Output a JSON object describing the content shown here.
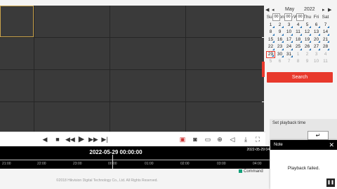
{
  "toolbar": {
    "icons": [
      "stop-all",
      "stop",
      "slow-down",
      "play",
      "speed-up",
      "frame"
    ]
  },
  "timeline": {
    "title": "2022-05-29 00:00:00",
    "edge_time": "2022-05-29 04",
    "ticks": [
      "21:00",
      "22:00",
      "23:00",
      "00:00",
      "01:00",
      "02:00",
      "03:00",
      "04:00"
    ]
  },
  "legend": [
    {
      "label": "Command",
      "color": "#13a07a"
    }
  ],
  "footer": "©2018 Hikvision Digital Technology Co., Ltd. All Rights Reserved.",
  "calendar": {
    "month": "May",
    "year": "2022",
    "weekdays": [
      "Sun",
      "Mon",
      "Tue",
      "Wed",
      "Thu",
      "Fri",
      "Sat"
    ],
    "days": [
      "1",
      "2",
      "3",
      "4",
      "5",
      "6",
      "7",
      "8",
      "9",
      "10",
      "11",
      "12",
      "13",
      "14",
      "15",
      "16",
      "17",
      "18",
      "19",
      "20",
      "21",
      "22",
      "23",
      "24",
      "25",
      "26",
      "27",
      "28",
      "29",
      "30",
      "31",
      "1",
      "2",
      "3",
      "4",
      "5",
      "6",
      "7",
      "8",
      "9",
      "10",
      "11"
    ],
    "selected_day": "29"
  },
  "search_label": "Search",
  "playback": {
    "title": "Set playback time",
    "hh": "00",
    "mm": "00",
    "ss": "00"
  },
  "note": {
    "title": "Note",
    "message": "Playback failed."
  },
  "colors": {
    "accent": "#e8392c",
    "record_marker": "#1f6fb3"
  }
}
